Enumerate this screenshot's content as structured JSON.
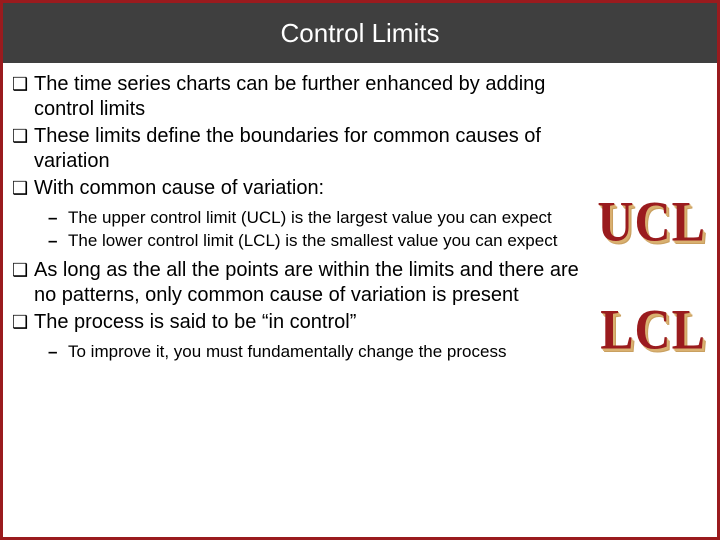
{
  "slide": {
    "title": "Control Limits",
    "bullets": {
      "b1": "The time series charts can be further enhanced by adding control limits",
      "b2": "These limits define the boundaries for common causes of variation",
      "b3": "With common cause of variation:",
      "b3_sub1": "The upper control limit (UCL) is the largest value you can expect",
      "b3_sub2": "The lower control limit (LCL) is the smallest value you can expect",
      "b4": "As long as the all the points are within the limits and there are no patterns, only common cause of variation is present",
      "b5": "The process is said to be “in control”",
      "b5_sub1": "To improve it, you must fundamentally change the process"
    },
    "markers": {
      "square": "❑",
      "dash": "–"
    },
    "wordart": {
      "ucl": "UCL",
      "lcl": "LCL"
    }
  }
}
